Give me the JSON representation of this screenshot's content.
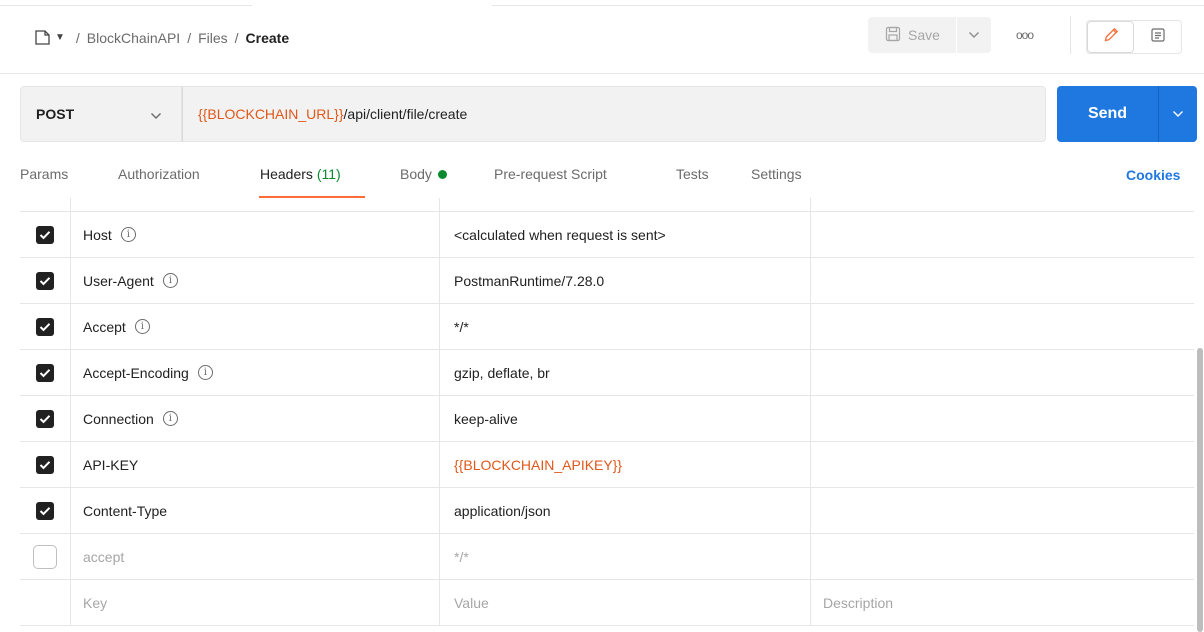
{
  "breadcrumb": {
    "parts": [
      "BlockChainAPI",
      "Files"
    ],
    "current": "Create",
    "separator": "/"
  },
  "toolbar": {
    "save_label": "Save",
    "more_label": "ooo",
    "icons": [
      "save-icon",
      "chevron-down-icon",
      "more-icon",
      "pencil-icon",
      "comment-icon"
    ]
  },
  "request": {
    "method": "POST",
    "url_variable": "{{BLOCKCHAIN_URL}}",
    "url_path": "/api/client/file/create",
    "send_label": "Send"
  },
  "tabs": [
    {
      "label": "Params"
    },
    {
      "label": "Authorization"
    },
    {
      "label": "Headers",
      "count": "(11)"
    },
    {
      "label": "Body"
    },
    {
      "label": "Pre-request Script"
    },
    {
      "label": "Tests"
    },
    {
      "label": "Settings"
    }
  ],
  "cookies_label": "Cookies",
  "headers": [
    {
      "key": "Host",
      "value": "<calculated when request is sent>",
      "checked": true,
      "info": true
    },
    {
      "key": "User-Agent",
      "value": "PostmanRuntime/7.28.0",
      "checked": true,
      "info": true
    },
    {
      "key": "Accept",
      "value": "*/*",
      "checked": true,
      "info": true
    },
    {
      "key": "Accept-Encoding",
      "value": "gzip, deflate, br",
      "checked": true,
      "info": true
    },
    {
      "key": "Connection",
      "value": "keep-alive",
      "checked": true,
      "info": true
    },
    {
      "key": "API-KEY",
      "value": "{{BLOCKCHAIN_APIKEY}}",
      "checked": true,
      "info": false
    },
    {
      "key": "Content-Type",
      "value": "application/json",
      "checked": true,
      "info": false
    },
    {
      "key": "accept",
      "value": "*/*",
      "checked": false,
      "info": false
    }
  ],
  "placeholders": {
    "key": "Key",
    "value": "Value",
    "description": "Description"
  },
  "colors": {
    "accent": "#ff6c37",
    "send": "#1f78e0",
    "variable": "#e0581a",
    "count": "#0a8a2e"
  }
}
